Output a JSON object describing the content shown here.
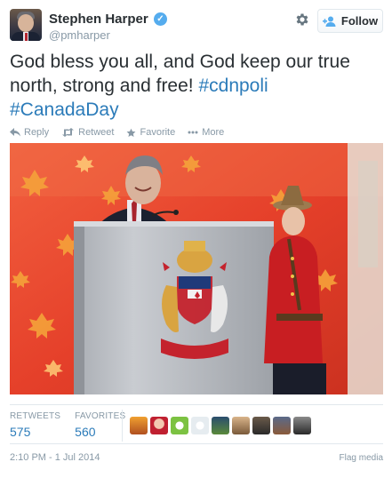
{
  "author": {
    "name": "Stephen Harper",
    "handle": "@pmharper",
    "verified": true
  },
  "follow_button": {
    "label": "Follow"
  },
  "tweet": {
    "text_plain": "God bless you all, and God keep our true north, strong and free! ",
    "hashtag1": "#cdnpoli",
    "hashtag2": "#CanadaDay"
  },
  "actions": {
    "reply": "Reply",
    "retweet": "Retweet",
    "favorite": "Favorite",
    "more": "More"
  },
  "stats": {
    "retweets_label": "RETWEETS",
    "retweets_value": "575",
    "favorites_label": "FAVORITES",
    "favorites_value": "560"
  },
  "favoriter_avatar_count": 9,
  "timestamp": "2:10 PM - 1 Jul 2014",
  "flag_media": "Flag media",
  "colors": {
    "link": "#2b7bb9",
    "muted": "#8899a6",
    "verified": "#55acee",
    "media_background": "#e8412d"
  },
  "icons": [
    "verified-badge-icon",
    "gear-icon",
    "follow-person-icon",
    "reply-icon",
    "retweet-icon",
    "favorite-star-icon",
    "more-dots-icon"
  ]
}
